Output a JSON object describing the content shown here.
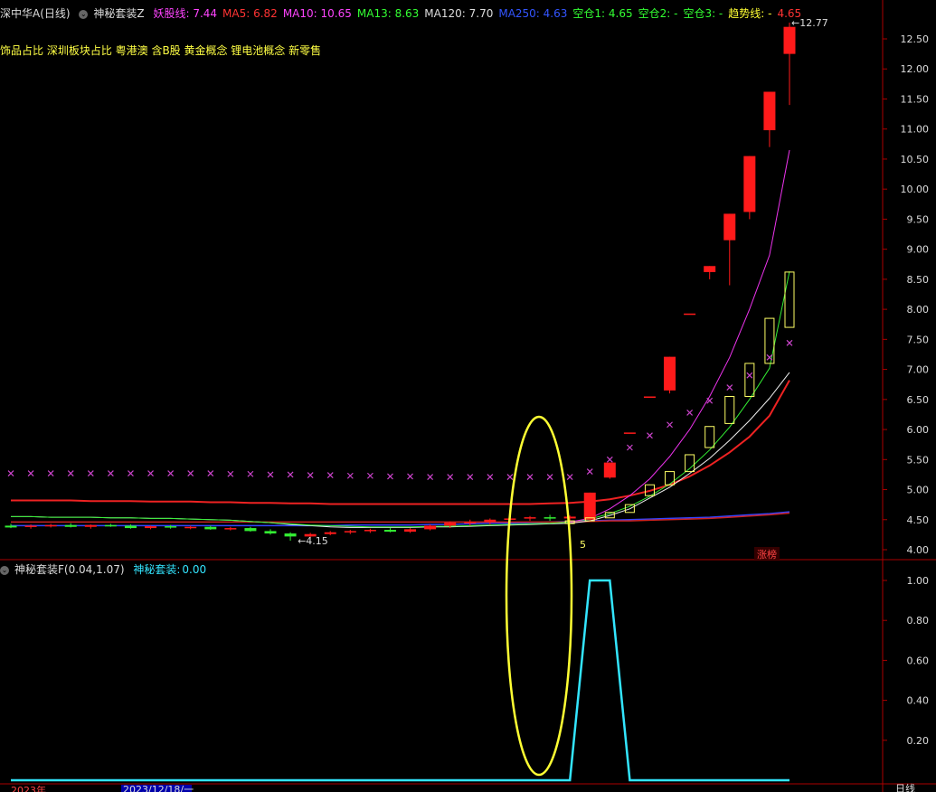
{
  "header": {
    "stock_name": "深中华A(日线)",
    "indicator_name": "神秘套装Z",
    "items": [
      {
        "label": "妖股线:",
        "value": "7.44",
        "color": "#ff44ff"
      },
      {
        "label": "MA5:",
        "value": "6.82",
        "color": "#ff3333"
      },
      {
        "label": "MA10:",
        "value": "10.65",
        "color": "#ff44ff"
      },
      {
        "label": "MA13:",
        "value": "8.63",
        "color": "#33ff33"
      },
      {
        "label": "MA120:",
        "value": "7.70",
        "color": "#dddddd"
      },
      {
        "label": "MA250:",
        "value": "4.63",
        "color": "#3355ff"
      },
      {
        "label": "空仓1:",
        "value": "4.65",
        "color": "#33ff33"
      },
      {
        "label": "空仓2:",
        "value": "-",
        "color": "#33ff33"
      },
      {
        "label": "空仓3:",
        "value": "-",
        "color": "#33ff33"
      },
      {
        "label": "趋势线:",
        "value": "-",
        "color": "#ffff33"
      },
      {
        "label": "",
        "value": "4.65",
        "color": "#ff3333"
      }
    ],
    "concepts": "饰品占比 深圳板块占比 粤港澳 含B股 黄金概念 锂电池概念 新零售"
  },
  "sub_header": {
    "indicator_name": "神秘套装F(0.04,1.07)",
    "label": "神秘套装:",
    "value": "0.00"
  },
  "annotations": {
    "high_label": "12.77",
    "low_label": "4.15",
    "count_label": "5",
    "limit_badge": "涨榜"
  },
  "bottom_axis": {
    "year_label": "2023年",
    "date_label": "2023/12/18/一",
    "period_label": "日线"
  },
  "colors": {
    "up": "#ff1a1a",
    "down": "#33ee33",
    "ma_white": "#eeeeee",
    "ma_magenta": "#ee33ee",
    "ma_green": "#33ee33",
    "ma_red": "#ee2222",
    "ma_blue": "#3344ff",
    "ellipse": "#ffff33",
    "sub_line": "#33e5ff",
    "axis": "#aa0000"
  },
  "chart_data": [
    {
      "type": "candlestick",
      "title": "深中华A(日线)",
      "ylim": [
        3.85,
        12.75
      ],
      "y_ticks": [
        4.0,
        4.5,
        5.0,
        5.5,
        6.0,
        6.5,
        7.0,
        7.5,
        8.0,
        8.5,
        9.0,
        9.5,
        10.0,
        10.5,
        11.0,
        11.5,
        12.0,
        12.5
      ],
      "candles": [
        {
          "o": 4.4,
          "h": 4.43,
          "l": 4.36,
          "c": 4.37
        },
        {
          "o": 4.38,
          "h": 4.42,
          "l": 4.35,
          "c": 4.4
        },
        {
          "o": 4.4,
          "h": 4.43,
          "l": 4.37,
          "c": 4.41
        },
        {
          "o": 4.41,
          "h": 4.44,
          "l": 4.37,
          "c": 4.38
        },
        {
          "o": 4.38,
          "h": 4.42,
          "l": 4.35,
          "c": 4.41
        },
        {
          "o": 4.41,
          "h": 4.43,
          "l": 4.38,
          "c": 4.4
        },
        {
          "o": 4.4,
          "h": 4.42,
          "l": 4.35,
          "c": 4.36
        },
        {
          "o": 4.36,
          "h": 4.4,
          "l": 4.34,
          "c": 4.39
        },
        {
          "o": 4.39,
          "h": 4.41,
          "l": 4.35,
          "c": 4.37
        },
        {
          "o": 4.37,
          "h": 4.4,
          "l": 4.34,
          "c": 4.38
        },
        {
          "o": 4.38,
          "h": 4.4,
          "l": 4.33,
          "c": 4.34
        },
        {
          "o": 4.34,
          "h": 4.38,
          "l": 4.32,
          "c": 4.36
        },
        {
          "o": 4.36,
          "h": 4.38,
          "l": 4.3,
          "c": 4.31
        },
        {
          "o": 4.31,
          "h": 4.34,
          "l": 4.25,
          "c": 4.27
        },
        {
          "o": 4.27,
          "h": 4.29,
          "l": 4.15,
          "c": 4.22
        },
        {
          "o": 4.22,
          "h": 4.28,
          "l": 4.2,
          "c": 4.26
        },
        {
          "o": 4.26,
          "h": 4.31,
          "l": 4.24,
          "c": 4.29
        },
        {
          "o": 4.29,
          "h": 4.33,
          "l": 4.26,
          "c": 4.31
        },
        {
          "o": 4.31,
          "h": 4.35,
          "l": 4.28,
          "c": 4.33
        },
        {
          "o": 4.33,
          "h": 4.36,
          "l": 4.29,
          "c": 4.3
        },
        {
          "o": 4.3,
          "h": 4.36,
          "l": 4.28,
          "c": 4.34
        },
        {
          "o": 4.34,
          "h": 4.42,
          "l": 4.32,
          "c": 4.4
        },
        {
          "o": 4.4,
          "h": 4.47,
          "l": 4.36,
          "c": 4.45
        },
        {
          "o": 4.45,
          "h": 4.5,
          "l": 4.4,
          "c": 4.46
        },
        {
          "o": 4.46,
          "h": 4.52,
          "l": 4.42,
          "c": 4.5
        },
        {
          "o": 4.5,
          "h": 4.55,
          "l": 4.46,
          "c": 4.52
        },
        {
          "o": 4.52,
          "h": 4.56,
          "l": 4.48,
          "c": 4.54
        },
        {
          "o": 4.54,
          "h": 4.58,
          "l": 4.48,
          "c": 4.52
        },
        {
          "o": 4.52,
          "h": 4.57,
          "l": 4.48,
          "c": 4.55
        },
        {
          "o": 4.5,
          "h": 4.95,
          "l": 4.48,
          "c": 4.95
        },
        {
          "o": 5.2,
          "h": 5.45,
          "l": 5.18,
          "c": 5.45
        },
        {
          "o": 5.95,
          "h": 5.95,
          "l": 5.95,
          "c": 5.95
        },
        {
          "o": 6.55,
          "h": 6.55,
          "l": 6.55,
          "c": 6.55
        },
        {
          "o": 6.65,
          "h": 7.21,
          "l": 6.6,
          "c": 7.21
        },
        {
          "o": 7.93,
          "h": 7.93,
          "l": 7.93,
          "c": 7.93
        },
        {
          "o": 8.62,
          "h": 8.72,
          "l": 8.5,
          "c": 8.72
        },
        {
          "o": 9.15,
          "h": 9.59,
          "l": 8.4,
          "c": 9.59
        },
        {
          "o": 9.62,
          "h": 10.55,
          "l": 9.5,
          "c": 10.55
        },
        {
          "o": 10.98,
          "h": 11.62,
          "l": 10.7,
          "c": 11.62
        },
        {
          "o": 12.25,
          "h": 12.77,
          "l": 11.4,
          "c": 12.7
        }
      ],
      "ma_white": [
        4.55,
        4.55,
        4.54,
        4.54,
        4.54,
        4.53,
        4.53,
        4.52,
        4.52,
        4.51,
        4.5,
        4.49,
        4.47,
        4.45,
        4.42,
        4.4,
        4.38,
        4.37,
        4.37,
        4.37,
        4.37,
        4.38,
        4.38,
        4.39,
        4.4,
        4.41,
        4.42,
        4.43,
        4.44,
        4.48,
        4.57,
        4.68,
        4.86,
        5.04,
        5.27,
        5.52,
        5.82,
        6.15,
        6.52,
        6.95
      ],
      "ma_magenta": [
        null,
        null,
        null,
        null,
        null,
        null,
        null,
        null,
        null,
        null,
        null,
        null,
        null,
        null,
        null,
        null,
        null,
        null,
        null,
        null,
        null,
        null,
        null,
        null,
        null,
        null,
        null,
        null,
        4.46,
        4.52,
        4.68,
        4.9,
        5.18,
        5.55,
        6.0,
        6.55,
        7.2,
        8.0,
        8.9,
        10.65
      ],
      "ma_green": [
        4.55,
        4.55,
        4.54,
        4.54,
        4.54,
        4.53,
        4.53,
        4.52,
        4.52,
        4.51,
        4.5,
        4.49,
        4.47,
        4.45,
        4.43,
        4.41,
        4.4,
        4.39,
        4.38,
        4.38,
        4.38,
        4.39,
        4.39,
        4.4,
        4.41,
        4.42,
        4.43,
        4.44,
        4.46,
        4.51,
        4.6,
        4.72,
        4.89,
        5.09,
        5.35,
        5.66,
        6.04,
        6.5,
        7.02,
        8.63
      ],
      "ma_red": [
        4.82,
        4.82,
        4.82,
        4.82,
        4.81,
        4.81,
        4.81,
        4.8,
        4.8,
        4.8,
        4.79,
        4.79,
        4.78,
        4.78,
        4.77,
        4.77,
        4.76,
        4.76,
        4.76,
        4.76,
        4.76,
        4.76,
        4.76,
        4.76,
        4.76,
        4.76,
        4.76,
        4.77,
        4.78,
        4.8,
        4.84,
        4.9,
        4.98,
        5.08,
        5.22,
        5.4,
        5.62,
        5.88,
        6.23,
        6.82
      ],
      "ma_blue": [
        4.4,
        4.4,
        4.4,
        4.4,
        4.4,
        4.4,
        4.4,
        4.4,
        4.4,
        4.4,
        4.4,
        4.4,
        4.4,
        4.4,
        4.4,
        4.4,
        4.4,
        4.41,
        4.41,
        4.41,
        4.41,
        4.42,
        4.42,
        4.43,
        4.44,
        4.44,
        4.45,
        4.46,
        4.47,
        4.48,
        4.49,
        4.5,
        4.51,
        4.52,
        4.53,
        4.54,
        4.56,
        4.58,
        4.6,
        4.63
      ],
      "ma_red_thin": [
        4.46,
        4.46,
        4.46,
        4.46,
        4.46,
        4.46,
        4.46,
        4.46,
        4.46,
        4.46,
        4.46,
        4.46,
        4.46,
        4.46,
        4.46,
        4.46,
        4.46,
        4.46,
        4.46,
        4.46,
        4.46,
        4.46,
        4.46,
        4.46,
        4.46,
        4.46,
        4.46,
        4.46,
        4.46,
        4.47,
        4.48,
        4.48,
        4.49,
        4.5,
        4.51,
        4.52,
        4.54,
        4.56,
        4.58,
        4.61
      ],
      "markers_x": [
        5.27,
        5.27,
        5.27,
        5.27,
        5.27,
        5.27,
        5.27,
        5.27,
        5.27,
        5.27,
        5.27,
        5.26,
        5.26,
        5.25,
        5.25,
        5.24,
        5.24,
        5.23,
        5.23,
        5.22,
        5.22,
        5.21,
        5.21,
        5.21,
        5.21,
        5.21,
        5.21,
        5.21,
        5.21,
        5.3,
        5.5,
        5.7,
        5.9,
        6.08,
        6.28,
        6.48,
        6.7,
        6.9,
        7.2,
        7.44
      ],
      "trend_boxes": [
        {
          "i": 28,
          "o": 4.44,
          "c": 4.48
        },
        {
          "i": 29,
          "o": 4.48,
          "c": 4.53
        },
        {
          "i": 30,
          "o": 4.53,
          "c": 4.62
        },
        {
          "i": 31,
          "o": 4.62,
          "c": 4.75
        },
        {
          "i": 32,
          "o": 4.9,
          "c": 5.08
        },
        {
          "i": 33,
          "o": 5.08,
          "c": 5.3
        },
        {
          "i": 34,
          "o": 5.3,
          "c": 5.58
        },
        {
          "i": 35,
          "o": 5.7,
          "c": 6.05
        },
        {
          "i": 36,
          "o": 6.1,
          "c": 6.55
        },
        {
          "i": 37,
          "o": 6.55,
          "c": 7.1
        },
        {
          "i": 38,
          "o": 7.1,
          "c": 7.85
        },
        {
          "i": 39,
          "o": 7.7,
          "c": 8.62
        }
      ]
    },
    {
      "type": "line",
      "title": "神秘套装F(0.04,1.07)",
      "ylim": [
        -0.05,
        1.05
      ],
      "y_ticks": [
        0.2,
        0.4,
        0.6,
        0.8,
        1.0
      ],
      "series": [
        {
          "name": "神秘套装",
          "values": [
            0,
            0,
            0,
            0,
            0,
            0,
            0,
            0,
            0,
            0,
            0,
            0,
            0,
            0,
            0,
            0,
            0,
            0,
            0,
            0,
            0,
            0,
            0,
            0,
            0,
            0,
            0,
            0,
            0,
            1,
            1,
            0,
            0,
            0,
            0,
            0,
            0,
            0,
            0,
            0
          ]
        }
      ]
    }
  ]
}
